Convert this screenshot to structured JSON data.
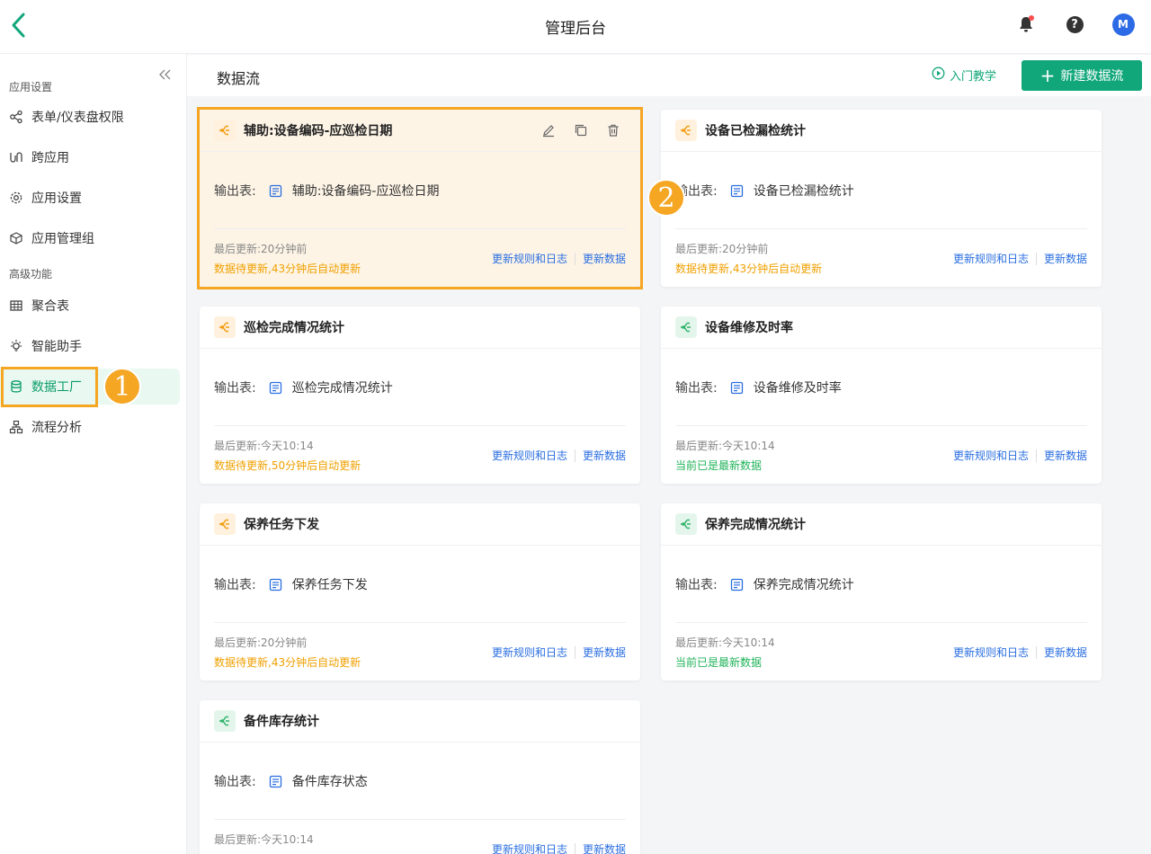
{
  "header": {
    "app_title": "管理后台",
    "avatar_letter": "M"
  },
  "sidebar": {
    "section_app": "应用设置",
    "section_advanced": "高级功能",
    "items": [
      {
        "label": "表单/仪表盘权限",
        "icon": "share-nodes-icon"
      },
      {
        "label": "跨应用",
        "icon": "cross-app-icon"
      },
      {
        "label": "应用设置",
        "icon": "gear-icon"
      },
      {
        "label": "应用管理组",
        "icon": "cube-icon"
      },
      {
        "label": "聚合表",
        "icon": "table-icon"
      },
      {
        "label": "智能助手",
        "icon": "lightbulb-icon"
      },
      {
        "label": "数据工厂",
        "icon": "database-icon"
      },
      {
        "label": "流程分析",
        "icon": "process-icon"
      }
    ]
  },
  "callouts": {
    "one": "1",
    "two": "2"
  },
  "main": {
    "page_title": "数据流",
    "tutorial_label": "入门教学",
    "new_button_label": "新建数据流",
    "output_label": "输出表:",
    "link_rules": "更新规则和日志",
    "link_update": "更新数据",
    "cards": [
      {
        "title": "辅助:设备编码-应巡检日期",
        "output": "辅助:设备编码-应巡检日期",
        "last_update": "最后更新:20分钟前",
        "status": "数据待更新,43分钟后自动更新",
        "status_type": "pending",
        "icon_color": "orange"
      },
      {
        "title": "设备已检漏检统计",
        "output": "设备已检漏检统计",
        "last_update": "最后更新:20分钟前",
        "status": "数据待更新,43分钟后自动更新",
        "status_type": "pending",
        "icon_color": "orange"
      },
      {
        "title": "巡检完成情况统计",
        "output": "巡检完成情况统计",
        "last_update": "最后更新:今天10:14",
        "status": "数据待更新,50分钟后自动更新",
        "status_type": "pending",
        "icon_color": "orange"
      },
      {
        "title": "设备维修及时率",
        "output": "设备维修及时率",
        "last_update": "最后更新:今天10:14",
        "status": "当前已是最新数据",
        "status_type": "ok",
        "icon_color": "green"
      },
      {
        "title": "保养任务下发",
        "output": "保养任务下发",
        "last_update": "最后更新:20分钟前",
        "status": "数据待更新,43分钟后自动更新",
        "status_type": "pending",
        "icon_color": "orange"
      },
      {
        "title": "保养完成情况统计",
        "output": "保养完成情况统计",
        "last_update": "最后更新:今天10:14",
        "status": "当前已是最新数据",
        "status_type": "ok",
        "icon_color": "green"
      },
      {
        "title": "备件库存统计",
        "output": "备件库存状态",
        "last_update": "最后更新:今天10:14",
        "status": "",
        "status_type": "none",
        "icon_color": "green"
      }
    ]
  },
  "colors": {
    "brand": "#11a77b",
    "highlight": "#f5a623",
    "link": "#2a6ee0",
    "pending": "#f0a000",
    "ok": "#21b35a"
  }
}
